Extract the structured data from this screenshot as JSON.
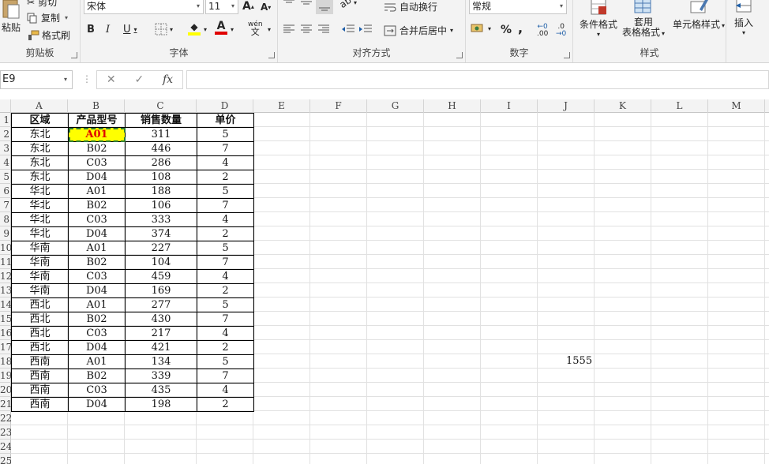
{
  "ribbon": {
    "clipboard": {
      "cut": "剪切",
      "copy": "复制",
      "format_painter": "格式刷",
      "paste": "粘贴",
      "label": "剪贴板"
    },
    "font": {
      "name": "宋体",
      "size": "11",
      "label": "字体",
      "bold": "B",
      "italic": "I",
      "underline": "U",
      "inc_size": "A",
      "dec_size": "A",
      "pinyin": "wén"
    },
    "alignment": {
      "wrap": "自动换行",
      "merge": "合并后居中",
      "label": "对齐方式"
    },
    "number": {
      "format": "常规",
      "percent": "%",
      "comma": ",",
      "inc_dec": ".00",
      "dec_dec": ".0",
      "label": "数字"
    },
    "styles": {
      "conditional": "条件格式",
      "table_line1": "套用",
      "table_line2": "表格格式",
      "cell_styles": "单元格样式",
      "label": "样式"
    },
    "cells": {
      "insert": "插入"
    }
  },
  "formula_bar": {
    "name_box": "E9",
    "cancel": "✕",
    "enter": "✓",
    "fx": "fx",
    "value": ""
  },
  "columns": [
    "A",
    "B",
    "C",
    "D",
    "E",
    "F",
    "G",
    "H",
    "I",
    "J",
    "K",
    "L",
    "M"
  ],
  "rows": [
    "1",
    "2",
    "3",
    "4",
    "5",
    "6",
    "7",
    "8",
    "9",
    "10",
    "11",
    "12",
    "13",
    "14",
    "15",
    "16",
    "17",
    "18",
    "19",
    "20",
    "21",
    "22",
    "23",
    "24",
    "25"
  ],
  "table": {
    "headers": [
      "区域",
      "产品型号",
      "销售数量",
      "单价"
    ],
    "rows": [
      [
        "东北",
        "A01",
        "311",
        "5"
      ],
      [
        "东北",
        "B02",
        "446",
        "7"
      ],
      [
        "东北",
        "C03",
        "286",
        "4"
      ],
      [
        "东北",
        "D04",
        "108",
        "2"
      ],
      [
        "华北",
        "A01",
        "188",
        "5"
      ],
      [
        "华北",
        "B02",
        "106",
        "7"
      ],
      [
        "华北",
        "C03",
        "333",
        "4"
      ],
      [
        "华北",
        "D04",
        "374",
        "2"
      ],
      [
        "华南",
        "A01",
        "227",
        "5"
      ],
      [
        "华南",
        "B02",
        "104",
        "7"
      ],
      [
        "华南",
        "C03",
        "459",
        "4"
      ],
      [
        "华南",
        "D04",
        "169",
        "2"
      ],
      [
        "西北",
        "A01",
        "277",
        "5"
      ],
      [
        "西北",
        "B02",
        "430",
        "7"
      ],
      [
        "西北",
        "C03",
        "217",
        "4"
      ],
      [
        "西北",
        "D04",
        "421",
        "2"
      ],
      [
        "西南",
        "A01",
        "134",
        "5"
      ],
      [
        "西南",
        "B02",
        "339",
        "7"
      ],
      [
        "西南",
        "C03",
        "435",
        "4"
      ],
      [
        "西南",
        "D04",
        "198",
        "2"
      ]
    ]
  },
  "free_cells": {
    "J17": "1555"
  },
  "colors": {
    "selected_fill": "#ffff00",
    "selected_text": "#e00000",
    "font_color": "#e00000",
    "highlight": "#ffff00"
  }
}
